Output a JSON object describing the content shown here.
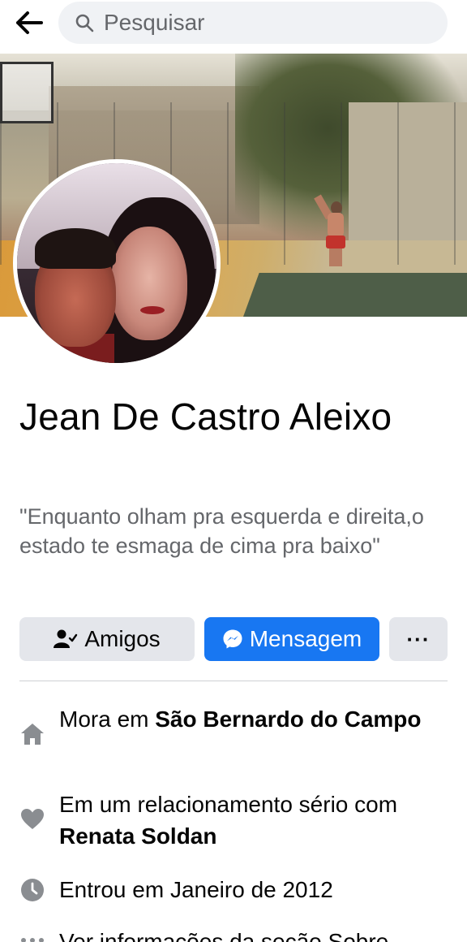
{
  "header": {
    "search_placeholder": "Pesquisar",
    "back_icon": "arrow-left-icon",
    "search_icon": "magnifier-icon"
  },
  "profile": {
    "name": "Jean De Castro Aleixo",
    "bio": "\"Enquanto olham pra esquerda e direita,o estado te esmaga de cima pra baixo\""
  },
  "actions": {
    "friends_label": "Amigos",
    "message_label": "Mensagem",
    "more_label": "···"
  },
  "details": {
    "lives_prefix": "Mora em ",
    "lives_place": "São Bernardo do Campo",
    "relationship_prefix": "Em um relacionamento sério com ",
    "relationship_partner": "Renata Soldan",
    "joined": "Entrou em Janeiro de 2012",
    "more_about": "Ver informações da seção Sobre"
  },
  "colors": {
    "accent": "#1877f2",
    "button_gray": "#e4e6eb",
    "secondary_text": "#65676b",
    "icon_gray": "#8a8d91"
  }
}
